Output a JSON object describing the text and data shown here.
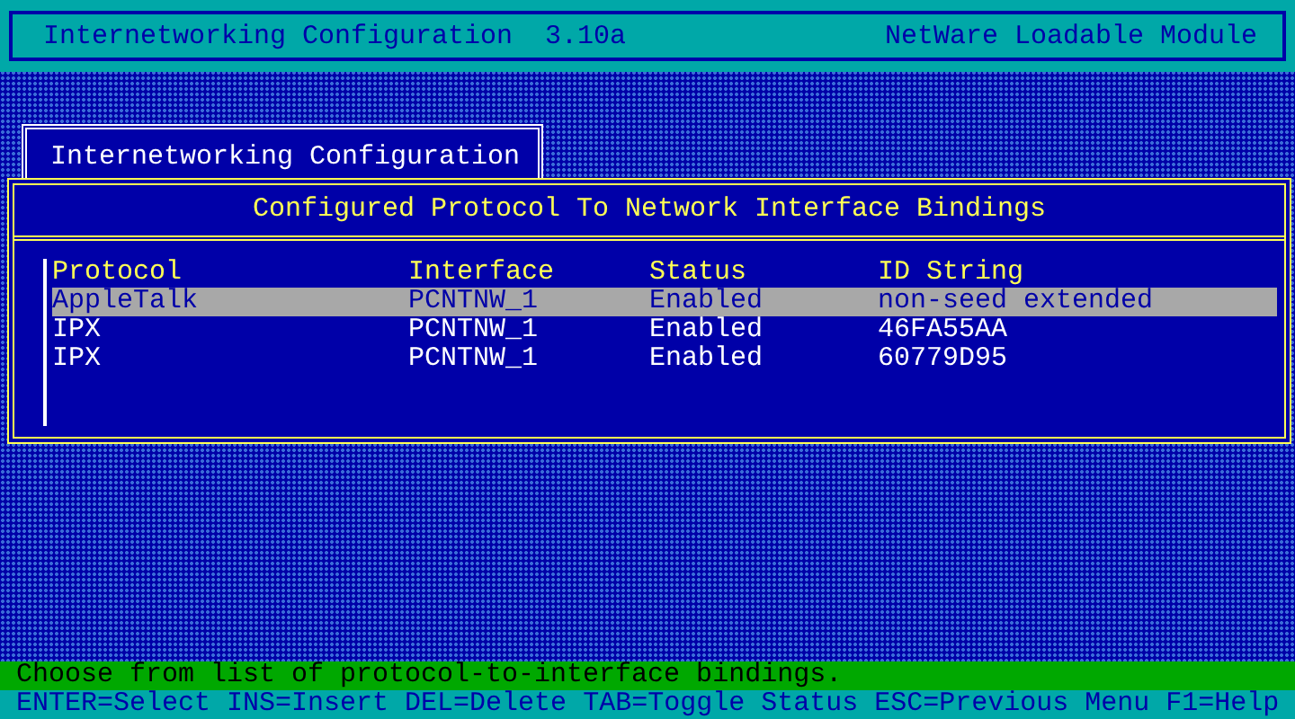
{
  "header": {
    "title": "Internetworking Configuration  3.10a",
    "module": "NetWare Loadable Module"
  },
  "menu_tab": {
    "label": "Internetworking Configuration"
  },
  "panel": {
    "title": "Configured Protocol To Network Interface Bindings",
    "columns": [
      "Protocol",
      "Interface",
      "Status",
      "ID String"
    ],
    "rows": [
      {
        "cells": [
          "AppleTalk",
          "PCNTNW_1",
          "Enabled",
          "non-seed extended"
        ],
        "selected": true
      },
      {
        "cells": [
          "IPX",
          "PCNTNW_1",
          "Enabled",
          "46FA55AA"
        ],
        "selected": false
      },
      {
        "cells": [
          "IPX",
          "PCNTNW_1",
          "Enabled",
          "60779D95"
        ],
        "selected": false
      }
    ]
  },
  "hint": "Choose from list of protocol-to-interface bindings.",
  "keys": [
    "ENTER=Select",
    "INS=Insert",
    "DEL=Delete",
    "TAB=Toggle Status",
    "ESC=Previous Menu",
    "F1=Help"
  ]
}
